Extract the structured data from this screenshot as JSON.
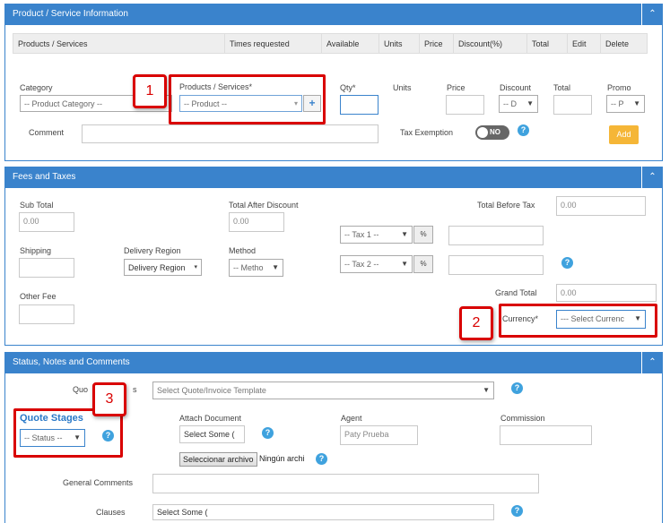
{
  "product_panel": {
    "title": "Product / Service Information",
    "toggle": "⌃",
    "table_headers": [
      "Products / Services",
      "Times requested",
      "Available",
      "Units",
      "Price",
      "Discount(%)",
      "Total",
      "Edit",
      "Delete"
    ],
    "category_label": "Category",
    "category_value": "-- Product Category --",
    "products_label": "Products / Services*",
    "product_value": "-- Product --",
    "add_product_btn": "+",
    "qty_label": "Qty*",
    "units_label": "Units",
    "price_label": "Price",
    "discount_label": "Discount",
    "discount_value": "-- D",
    "total_label": "Total",
    "promo_label": "Promo",
    "promo_value": "-- P",
    "comment_label": "Comment",
    "tax_exemption_label": "Tax Exemption",
    "tax_toggle": "NO",
    "add_btn": "Add"
  },
  "fees_panel": {
    "title": "Fees and Taxes",
    "toggle": "⌃",
    "sub_total_label": "Sub Total",
    "sub_total_value": "0.00",
    "total_after_discount_label": "Total After Discount",
    "total_after_discount_value": "0.00",
    "total_before_tax_label": "Total Before Tax",
    "total_before_tax_value": "0.00",
    "shipping_label": "Shipping",
    "delivery_region_label": "Delivery Region",
    "delivery_region_value": "Delivery Region",
    "method_label": "Method",
    "method_value": "-- Metho",
    "tax1_value": "-- Tax 1 --",
    "tax2_value": "-- Tax 2 --",
    "percent": "%",
    "other_fee_label": "Other Fee",
    "grand_total_label": "Grand Total",
    "grand_total_value": "0.00",
    "currency_label": "Currency*",
    "currency_value": "--- Select Currenc"
  },
  "status_panel": {
    "title": "Status, Notes and Comments",
    "toggle": "⌃",
    "template_label_left": "Quo",
    "template_label_right": "s",
    "template_value": "Select Quote/Invoice Template",
    "quote_stages_label": "Quote Stages",
    "status_value": "-- Status --",
    "attach_document_label": "Attach Document",
    "attach_select": "Select Some (",
    "file_button": "Seleccionar archivo",
    "file_status": "Ningún archi",
    "agent_label": "Agent",
    "agent_value": "Paty Prueba",
    "commission_label": "Commission",
    "general_comments_label": "General Comments",
    "clauses_label": "Clauses",
    "clauses_value": "Select Some ("
  },
  "callouts": [
    "1",
    "2",
    "3"
  ],
  "help_glyph": "?",
  "dropdown_glyph": "▼",
  "colors": {
    "header_blue": "#3a83cc",
    "callout_red": "#d90000",
    "add_orange": "#f5b637",
    "help_blue": "#3fa2de"
  }
}
